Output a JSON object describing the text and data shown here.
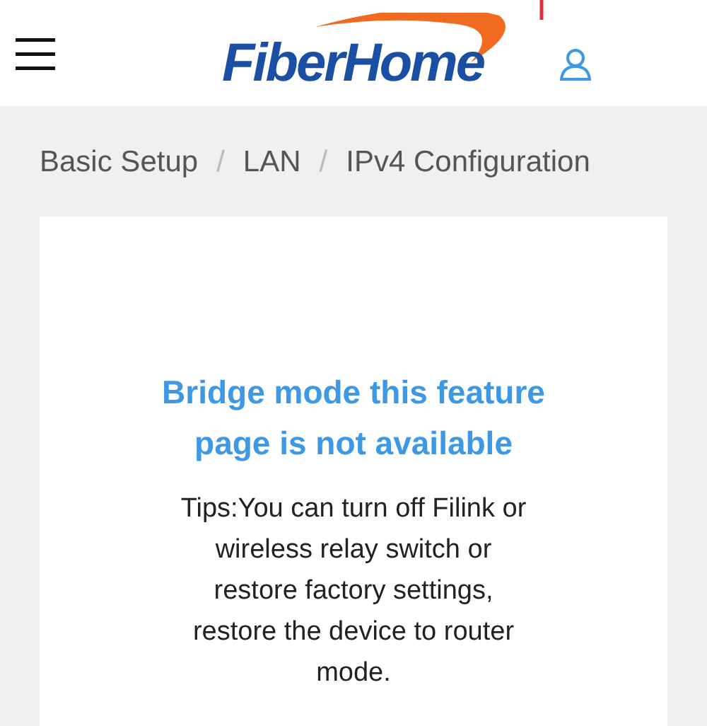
{
  "header": {
    "logo": "FiberHome"
  },
  "breadcrumb": [
    {
      "kind": "item",
      "text": "Basic Setup"
    },
    {
      "kind": "separator",
      "text": "/"
    },
    {
      "kind": "item",
      "text": "LAN"
    },
    {
      "kind": "separator",
      "text": "/"
    },
    {
      "kind": "item",
      "text": "IPv4 Configuration"
    }
  ],
  "notice": {
    "title": "Bridge mode this feature page is not available",
    "tips": "Tips:You can turn off Filink or wireless relay switch or restore factory settings, restore the device to router mode."
  }
}
